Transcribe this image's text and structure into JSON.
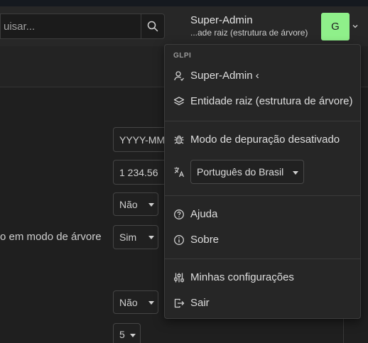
{
  "header": {
    "search_placeholder": "uisar...",
    "user_name": "Super-Admin",
    "user_entity": "...ade raiz (estrutura de árvore)",
    "avatar_initial": "G"
  },
  "background": {
    "date_field": "YYYY-MM",
    "number_field": "1 234.56",
    "select_1": "Não",
    "tree_label": "o em modo de árvore",
    "select_2": "Sim",
    "select_3": "Não",
    "select_4": "5"
  },
  "dropdown": {
    "section_title": "GLPI",
    "profile_label": "Super-Admin ‹",
    "entity_label": "Entidade raiz (estrutura de árvore)",
    "debug_label": "Modo de depuração desativado",
    "language_value": "Português do Brasil",
    "help_label": "Ajuda",
    "about_label": "Sobre",
    "settings_label": "Minhas configurações",
    "logout_label": "Sair"
  },
  "colors": {
    "avatar_bg": "#8ff08a",
    "background": "#1f1f1f",
    "menu_bg": "#262626"
  },
  "icons": [
    "search-icon",
    "chevron-down-icon",
    "user-icon",
    "layers-icon",
    "bug-icon",
    "translate-icon",
    "help-circle-icon",
    "info-circle-icon",
    "sliders-icon",
    "logout-icon"
  ]
}
